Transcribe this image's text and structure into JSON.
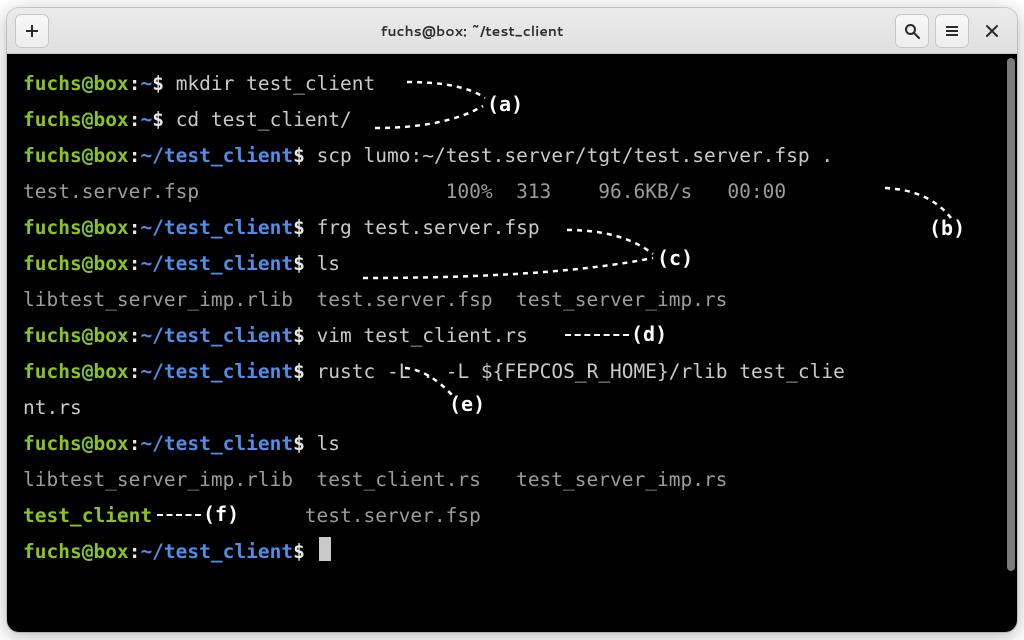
{
  "window": {
    "title": "fuchs@box: ~/test_client"
  },
  "prompt": {
    "user": "fuchs",
    "at": "@",
    "host": "box",
    "colon": ":",
    "home": "~",
    "cwd": "~/test_client",
    "symbol": "$"
  },
  "lines": {
    "l1_cmd": "mkdir test_client",
    "l2_cmd": "cd test_client/",
    "l3_cmd": "scp lumo:~/test.server/tgt/test.server.fsp .",
    "l4_out": "test.server.fsp                     100%  313    96.6KB/s   00:00",
    "l5_cmd": "frg test.server.fsp",
    "l6_cmd": "ls",
    "l7_out": "libtest_server_imp.rlib  test.server.fsp  test_server_imp.rs",
    "l8_cmd": "vim test_client.rs",
    "l9_cmd": "rustc -L . -L ${FEPCOS_R_HOME}/rlib test_clie",
    "l9_wrap": "nt.rs",
    "l10_cmd": "ls",
    "l11_out_a": "libtest_server_imp.rlib  test_client.rs   test_server_imp.rs",
    "l12_exe": "test_client",
    "l12_out": "             test.server.fsp"
  },
  "annotations": {
    "a": "(a)",
    "b": "(b)",
    "c": "(c)",
    "d": "(d)",
    "e": "(e)",
    "f": "(f)"
  }
}
